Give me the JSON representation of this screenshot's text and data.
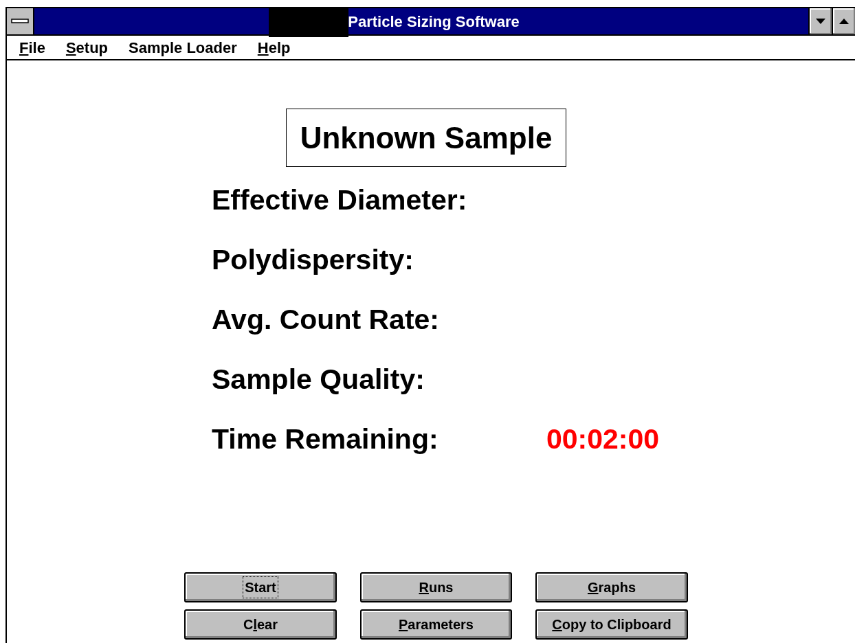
{
  "window": {
    "title": "Particle Sizing Software"
  },
  "menu": [
    {
      "parts": [
        {
          "text": "F",
          "underlined": true
        },
        {
          "text": "ile",
          "underlined": false
        }
      ]
    },
    {
      "parts": [
        {
          "text": "S",
          "underlined": true
        },
        {
          "text": "etup",
          "underlined": false
        }
      ]
    },
    {
      "parts": [
        {
          "text": "Sample Loader",
          "underlined": false
        }
      ]
    },
    {
      "parts": [
        {
          "text": "H",
          "underlined": true
        },
        {
          "text": "elp",
          "underlined": false
        }
      ]
    }
  ],
  "sample_name": "Unknown Sample",
  "results": [
    {
      "label": "Effective Diameter:"
    },
    {
      "label": "Polydispersity:"
    },
    {
      "label": "Avg. Count Rate:"
    },
    {
      "label": "Sample Quality:"
    },
    {
      "label": "Time Remaining:",
      "value": "00:02:00"
    }
  ],
  "buttons": [
    {
      "focused": true,
      "parts": [
        {
          "text": "Start",
          "underlined": false
        }
      ]
    },
    {
      "focused": false,
      "parts": [
        {
          "text": "R",
          "underlined": true
        },
        {
          "text": "uns",
          "underlined": false
        }
      ]
    },
    {
      "focused": false,
      "parts": [
        {
          "text": "G",
          "underlined": true
        },
        {
          "text": "raphs",
          "underlined": false
        }
      ]
    },
    {
      "focused": false,
      "parts": [
        {
          "text": "C",
          "underlined": false
        },
        {
          "text": "l",
          "underlined": true
        },
        {
          "text": "ear",
          "underlined": false
        }
      ]
    },
    {
      "focused": false,
      "parts": [
        {
          "text": "P",
          "underlined": true
        },
        {
          "text": "arameters",
          "underlined": false
        }
      ]
    },
    {
      "focused": false,
      "parts": [
        {
          "text": "C",
          "underlined": true
        },
        {
          "text": "opy to Clipboard",
          "underlined": false
        }
      ]
    }
  ]
}
